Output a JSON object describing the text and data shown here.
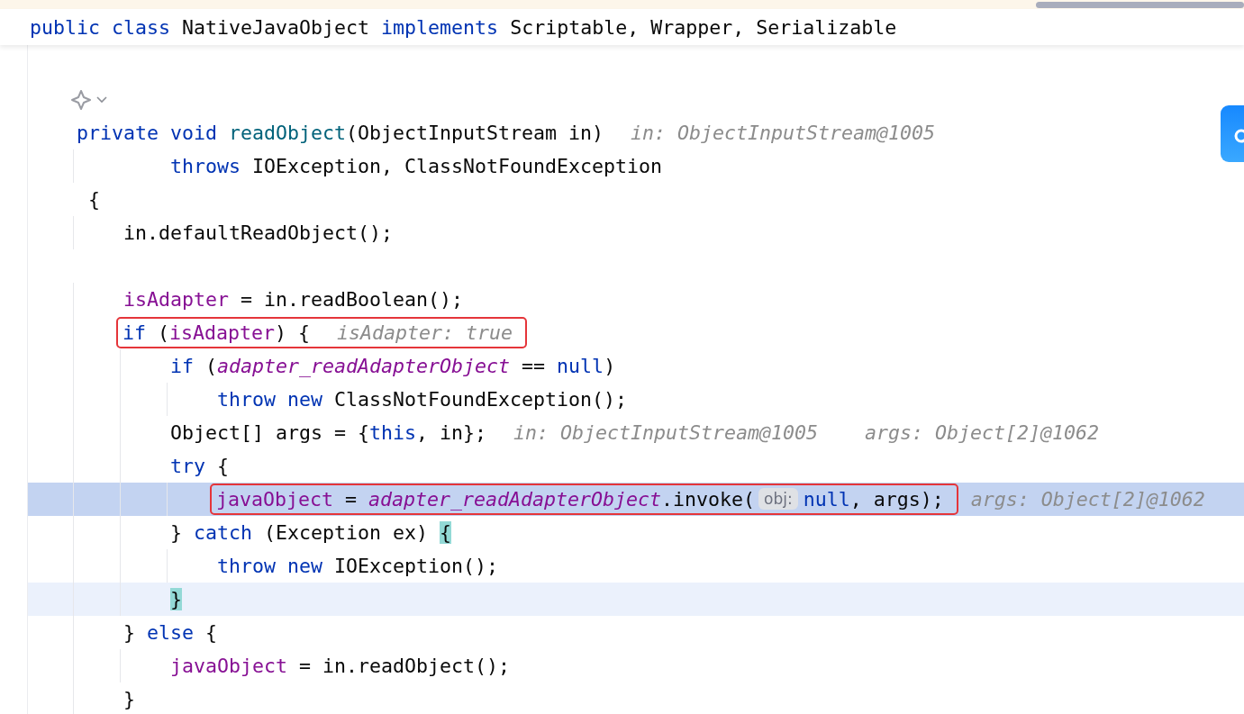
{
  "sticky_header": {
    "tokens": [
      {
        "text": "public ",
        "kind": "keyword"
      },
      {
        "text": "class ",
        "kind": "keyword"
      },
      {
        "text": "NativeJavaObject ",
        "kind": "plain"
      },
      {
        "text": "implements ",
        "kind": "keyword"
      },
      {
        "text": "Scriptable, Wrapper, Serializable",
        "kind": "plain"
      }
    ]
  },
  "lines": [
    {
      "kind": "blank"
    },
    {
      "kind": "inlay_icon"
    },
    {
      "kind": "code",
      "tokens": [
        {
          "text": "private ",
          "kind": "keyword"
        },
        {
          "text": "void ",
          "kind": "keyword"
        },
        {
          "text": "readObject",
          "kind": "method"
        },
        {
          "text": "(ObjectInputStream in)",
          "kind": "plain"
        },
        {
          "text": "in: ObjectInputStream@1005",
          "kind": "hint"
        }
      ],
      "children": [
        {
          "kind": "continuation",
          "tokens": [
            {
              "text": "throws ",
              "kind": "keyword"
            },
            {
              "text": "IOException, ClassNotFoundException",
              "kind": "plain"
            }
          ]
        }
      ]
    },
    {
      "kind": "offset_code",
      "tokens": [
        {
          "text": "{",
          "kind": "plain"
        }
      ],
      "children": [
        {
          "kind": "code",
          "tokens": [
            {
              "text": "in.defaultReadObject();",
              "kind": "plain"
            }
          ]
        },
        {
          "kind": "blank"
        },
        {
          "kind": "code",
          "tokens": [
            {
              "text": "isAdapter ",
              "kind": "field"
            },
            {
              "text": "= in.readBoolean();",
              "kind": "plain"
            }
          ]
        },
        {
          "kind": "code",
          "tokens": [
            {
              "kind": "box",
              "tokens": [
                {
                  "text": "if ",
                  "kind": "keyword"
                },
                {
                  "text": "(",
                  "kind": "plain"
                },
                {
                  "text": "isAdapter",
                  "kind": "field"
                },
                {
                  "text": ") {",
                  "kind": "plain"
                },
                {
                  "text": "isAdapter: true",
                  "kind": "hint"
                }
              ]
            }
          ],
          "children": [
            {
              "kind": "code",
              "tokens": [
                {
                  "text": "if ",
                  "kind": "keyword"
                },
                {
                  "text": "(",
                  "kind": "plain"
                },
                {
                  "text": "adapter_readAdapterObject ",
                  "kind": "static"
                },
                {
                  "text": "== ",
                  "kind": "plain"
                },
                {
                  "text": "null",
                  "kind": "keyword"
                },
                {
                  "text": ")",
                  "kind": "plain"
                }
              ],
              "children": [
                {
                  "kind": "code",
                  "tokens": [
                    {
                      "text": "throw ",
                      "kind": "keyword"
                    },
                    {
                      "text": "new ",
                      "kind": "keyword"
                    },
                    {
                      "text": "ClassNotFoundException();",
                      "kind": "plain"
                    }
                  ]
                }
              ]
            },
            {
              "kind": "code",
              "tokens": [
                {
                  "text": "Object[] args = {",
                  "kind": "plain"
                },
                {
                  "text": "this",
                  "kind": "keyword"
                },
                {
                  "text": ", in};",
                  "kind": "plain"
                },
                {
                  "text": "in: ObjectInputStream@1005",
                  "kind": "hint"
                },
                {
                  "text": "args: Object[2]@1062",
                  "kind": "hint"
                }
              ]
            },
            {
              "kind": "code",
              "tokens": [
                {
                  "text": "try ",
                  "kind": "keyword"
                },
                {
                  "text": "{",
                  "kind": "plain"
                }
              ],
              "children": [
                {
                  "kind": "code",
                  "execution_point": true,
                  "tokens": [
                    {
                      "kind": "box",
                      "tokens": [
                        {
                          "text": "javaObject ",
                          "kind": "field"
                        },
                        {
                          "text": "= ",
                          "kind": "plain"
                        },
                        {
                          "text": "adapter_readAdapterObject",
                          "kind": "static"
                        },
                        {
                          "text": ".invoke(",
                          "kind": "plain"
                        },
                        {
                          "text": "obj:",
                          "kind": "param"
                        },
                        {
                          "text": "null",
                          "kind": "keyword"
                        },
                        {
                          "text": ", args);",
                          "kind": "plain"
                        }
                      ]
                    },
                    {
                      "text": "args: Object[2]@1062",
                      "kind": "hint"
                    }
                  ]
                }
              ]
            },
            {
              "kind": "code",
              "tokens": [
                {
                  "text": "} ",
                  "kind": "plain"
                },
                {
                  "text": "catch ",
                  "kind": "keyword"
                },
                {
                  "text": "(Exception ex) ",
                  "kind": "plain"
                },
                {
                  "text": "{",
                  "kind": "brace"
                }
              ],
              "children": [
                {
                  "kind": "code",
                  "tokens": [
                    {
                      "text": "throw ",
                      "kind": "keyword"
                    },
                    {
                      "text": "new ",
                      "kind": "keyword"
                    },
                    {
                      "text": "IOException();",
                      "kind": "plain"
                    }
                  ]
                }
              ]
            },
            {
              "kind": "code",
              "caret_line": true,
              "tokens": [
                {
                  "text": "}",
                  "kind": "brace"
                }
              ]
            }
          ]
        },
        {
          "kind": "code",
          "tokens": [
            {
              "text": "} ",
              "kind": "plain"
            },
            {
              "text": "else ",
              "kind": "keyword"
            },
            {
              "text": "{",
              "kind": "plain"
            }
          ],
          "children": [
            {
              "kind": "code",
              "tokens": [
                {
                  "text": "javaObject ",
                  "kind": "field"
                },
                {
                  "text": "= in.readObject();",
                  "kind": "plain"
                }
              ]
            }
          ]
        },
        {
          "kind": "code",
          "tokens": [
            {
              "text": "}",
              "kind": "plain"
            }
          ]
        }
      ]
    }
  ]
}
